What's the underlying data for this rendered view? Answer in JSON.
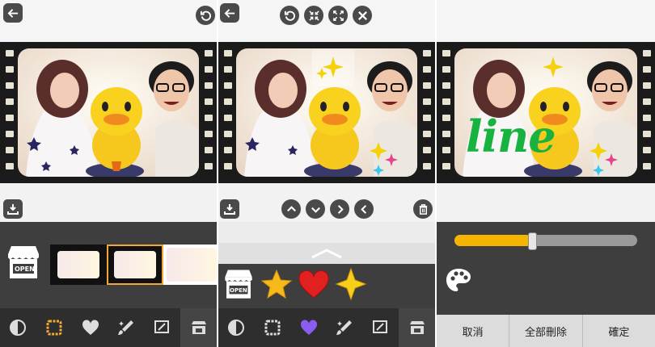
{
  "panels": [
    {
      "id": "frame-editor",
      "top_icons": [
        "back-arrow-icon",
        "rotate-icon"
      ],
      "mid_left_icon": "download-icon",
      "tabs": [
        {
          "icon": "contrast-icon",
          "selected": false
        },
        {
          "icon": "frame-icon",
          "selected": true
        },
        {
          "icon": "heart-icon",
          "selected": false
        },
        {
          "icon": "magic-brush-icon",
          "selected": false
        },
        {
          "icon": "edit-text-icon",
          "selected": false
        },
        {
          "icon": "shop-icon",
          "selected": false
        }
      ],
      "shop_label": "OPEN",
      "thumbnails_count_visible": 3
    },
    {
      "id": "sticker-editor",
      "top_icons": [
        "back-arrow-icon",
        "undo-icon",
        "shrink-icon",
        "expand-icon",
        "close-icon"
      ],
      "mid_icons": [
        "download-icon",
        "up-icon",
        "down-icon",
        "right-icon",
        "left-icon",
        "trash-icon"
      ],
      "shop_label": "OPEN",
      "stickers": [
        "star-sticker",
        "heart-sticker",
        "sparkle-sticker"
      ],
      "tabs": [
        {
          "icon": "contrast-icon",
          "selected": false
        },
        {
          "icon": "frame-icon",
          "selected": false
        },
        {
          "icon": "heart-icon",
          "selected": false,
          "color": "#8a5cf0"
        },
        {
          "icon": "magic-brush-icon",
          "selected": false
        },
        {
          "icon": "edit-text-icon",
          "selected": false
        },
        {
          "icon": "shop-icon",
          "selected": true
        }
      ]
    },
    {
      "id": "draw-editor",
      "doodle_text": "line",
      "slider": {
        "value": 0.42,
        "color": "#f5b400"
      },
      "palette_icon": "palette-icon",
      "buttons": {
        "cancel": "取消",
        "delete_all": "全部刪除",
        "confirm": "確定"
      }
    }
  ],
  "colors": {
    "dark_bar": "#3e3e3e",
    "tab_bar": "#2e2e2e",
    "accent": "#f1a830",
    "film": "#1b1b1b"
  }
}
